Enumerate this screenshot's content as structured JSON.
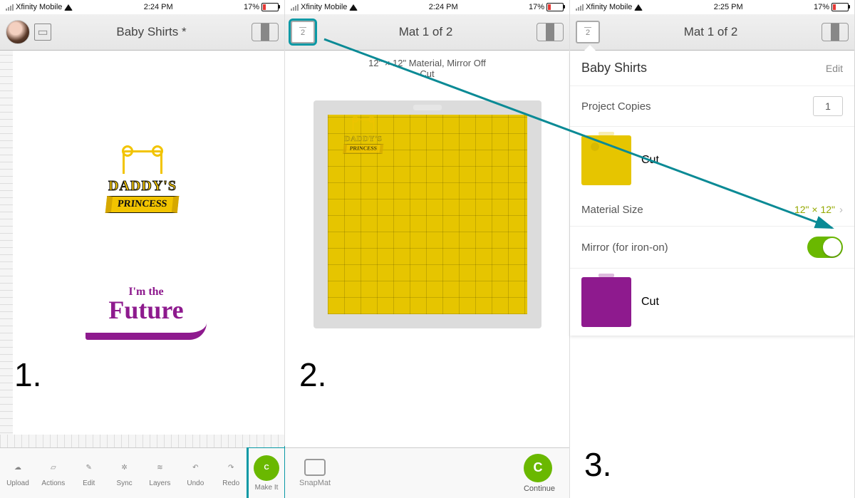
{
  "status": {
    "carrier": "Xfinity Mobile",
    "time1": "2:24 PM",
    "time2": "2:24 PM",
    "time3": "2:25 PM",
    "battery": "17%"
  },
  "p1": {
    "title": "Baby Shirts *",
    "art1_line1": "DADDY'S",
    "art1_line2": "PRINCESS",
    "art2_line1": "I'm the",
    "art2_line2": "Future",
    "tools": [
      "Upload",
      "Actions",
      "Edit",
      "Sync",
      "Layers",
      "Undo",
      "Redo",
      "Make It"
    ]
  },
  "p2": {
    "title": "Mat 1 of 2",
    "matbtn": "2",
    "info1": "12\" × 12\" Material, Mirror Off",
    "info2": "Cut",
    "snapmat": "SnapMat",
    "continue": "Continue"
  },
  "p3": {
    "title": "Mat 1 of 2",
    "matbtn": "2",
    "project": "Baby Shirts",
    "edit": "Edit",
    "copies_label": "Project Copies",
    "copies_val": "1",
    "cut": "Cut",
    "size_label": "Material Size",
    "size_val": "12\" × 12\"",
    "mirror_label": "Mirror (for iron-on)"
  },
  "steps": {
    "s1": "1.",
    "s2": "2.",
    "s3": "3."
  }
}
